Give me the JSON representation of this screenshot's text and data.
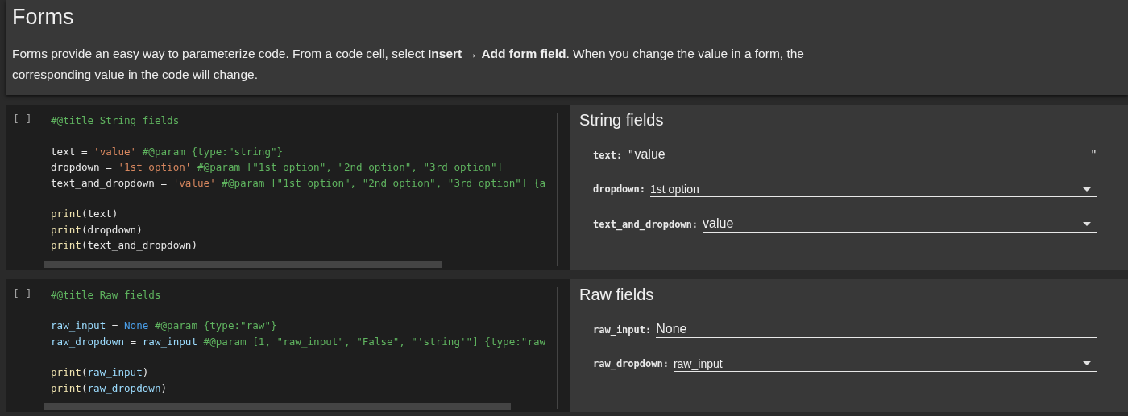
{
  "header": {
    "title": "Forms",
    "description": "Forms provide an easy way to parameterize code. From a code cell, select **Insert** → **Add form field**. When you change the value in a form, the corresponding value in the code will change."
  },
  "cells": [
    {
      "run_marker": "[ ]",
      "code_blocks": [
        [
          [
            {
              "kind": "comment",
              "text": "#@title String fields"
            }
          ]
        ],
        [
          [
            {
              "kind": "plain",
              "text": "text = "
            },
            {
              "kind": "string",
              "text": "'value'"
            },
            {
              "kind": "comment",
              "text": " #@param {type:\"string\"}"
            }
          ],
          [
            {
              "kind": "plain",
              "text": "dropdown = "
            },
            {
              "kind": "string",
              "text": "'1st option'"
            },
            {
              "kind": "comment",
              "text": " #@param [\"1st option\", \"2nd option\", \"3rd option\"]"
            }
          ],
          [
            {
              "kind": "plain",
              "text": "text_and_dropdown = "
            },
            {
              "kind": "string",
              "text": "'value'"
            },
            {
              "kind": "comment",
              "text": " #@param [\"1st option\", \"2nd option\", \"3rd option\"] {a"
            }
          ]
        ],
        [
          [
            {
              "kind": "function",
              "text": "print"
            },
            {
              "kind": "plain",
              "text": "(text)"
            }
          ],
          [
            {
              "kind": "function",
              "text": "print"
            },
            {
              "kind": "plain",
              "text": "(dropdown)"
            }
          ],
          [
            {
              "kind": "function",
              "text": "print"
            },
            {
              "kind": "plain",
              "text": "(text_and_dropdown)"
            }
          ]
        ]
      ],
      "form": {
        "title": "String fields",
        "fields": [
          {
            "kind": "text",
            "label": "text:",
            "value": "value",
            "quote_open": "\"",
            "quote_close": "\""
          },
          {
            "kind": "dropdown",
            "label": "dropdown:",
            "value": "1st option"
          },
          {
            "kind": "combo",
            "label": "text_and_dropdown:",
            "value": "value"
          }
        ]
      }
    },
    {
      "run_marker": "[ ]",
      "code_blocks": [
        [
          [
            {
              "kind": "comment",
              "text": "#@title Raw fields"
            }
          ]
        ],
        [
          [
            {
              "kind": "variable",
              "text": "raw_input"
            },
            {
              "kind": "plain",
              "text": " = "
            },
            {
              "kind": "keyword",
              "text": "None"
            },
            {
              "kind": "comment",
              "text": " #@param {type:\"raw\"}"
            }
          ],
          [
            {
              "kind": "variable",
              "text": "raw_dropdown"
            },
            {
              "kind": "plain",
              "text": " = "
            },
            {
              "kind": "variable",
              "text": "raw_input"
            },
            {
              "kind": "comment",
              "text": " #@param [1, \"raw_input\", \"False\", \"'string'\"] {type:\"raw"
            }
          ]
        ],
        [
          [
            {
              "kind": "function",
              "text": "print"
            },
            {
              "kind": "plain",
              "text": "("
            },
            {
              "kind": "variable",
              "text": "raw_input"
            },
            {
              "kind": "plain",
              "text": ")"
            }
          ],
          [
            {
              "kind": "function",
              "text": "print"
            },
            {
              "kind": "plain",
              "text": "("
            },
            {
              "kind": "variable",
              "text": "raw_dropdown"
            },
            {
              "kind": "plain",
              "text": ")"
            }
          ]
        ]
      ],
      "form": {
        "title": "Raw fields",
        "fields": [
          {
            "kind": "raw",
            "label": "raw_input:",
            "value": "None"
          },
          {
            "kind": "dropdown",
            "label": "raw_dropdown:",
            "value": "raw_input"
          }
        ]
      }
    }
  ]
}
